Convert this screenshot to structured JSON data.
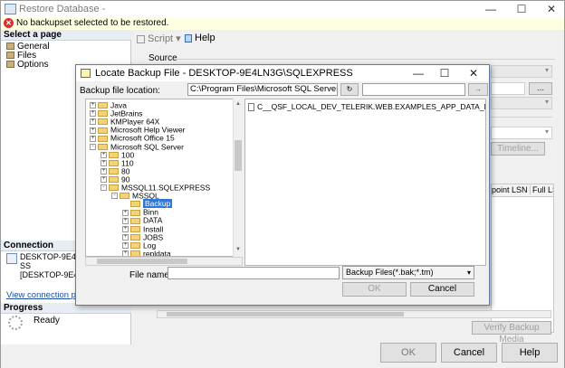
{
  "window": {
    "title": "Restore Database -",
    "warning": "No backupset selected to be restored."
  },
  "left": {
    "select_page_header": "Select a page",
    "pages": [
      {
        "label": "General"
      },
      {
        "label": "Files"
      },
      {
        "label": "Options"
      }
    ],
    "connection_header": "Connection",
    "connection_line1": "DESKTOP-9E4LN",
    "connection_line2": "SS",
    "connection_line3": "[DESKTOP-9E4LN",
    "view_connection_link": "View connection pro",
    "progress_header": "Progress",
    "progress_status": "Ready"
  },
  "toolbar": {
    "script_label": "Script",
    "help_label": "Help"
  },
  "main": {
    "source_label": "Source",
    "browse_button": "...",
    "timeline_button": "Timeline...",
    "col_headers": [
      "point LSN",
      "Full LS"
    ],
    "verify_button": "Verify Backup Media"
  },
  "bottom": {
    "ok": "OK",
    "cancel": "Cancel",
    "help": "Help"
  },
  "dialog": {
    "title": "Locate Backup File - DESKTOP-9E4LN3G\\SQLEXPRESS",
    "location_label": "Backup file location:",
    "location_value": "C:\\Program Files\\Microsoft SQL Server\\MSSQ",
    "tree": [
      {
        "label": "Java",
        "depth": 1,
        "exp": "+"
      },
      {
        "label": "JetBrains",
        "depth": 1,
        "exp": "+"
      },
      {
        "label": "KMPlayer 64X",
        "depth": 1,
        "exp": "+"
      },
      {
        "label": "Microsoft Help Viewer",
        "depth": 1,
        "exp": "+"
      },
      {
        "label": "Microsoft Office 15",
        "depth": 1,
        "exp": "+"
      },
      {
        "label": "Microsoft SQL Server",
        "depth": 1,
        "exp": "-"
      },
      {
        "label": "100",
        "depth": 2,
        "exp": "+"
      },
      {
        "label": "110",
        "depth": 2,
        "exp": "+"
      },
      {
        "label": "80",
        "depth": 2,
        "exp": "+"
      },
      {
        "label": "90",
        "depth": 2,
        "exp": "+"
      },
      {
        "label": "MSSQL11.SQLEXPRESS",
        "depth": 2,
        "exp": "-"
      },
      {
        "label": "MSSQL",
        "depth": 3,
        "exp": "-"
      },
      {
        "label": "Backup",
        "depth": 4,
        "exp": "",
        "selected": true
      },
      {
        "label": "Binn",
        "depth": 4,
        "exp": "+"
      },
      {
        "label": "DATA",
        "depth": 4,
        "exp": "+"
      },
      {
        "label": "Install",
        "depth": 4,
        "exp": "+"
      },
      {
        "label": "JOBS",
        "depth": 4,
        "exp": "+"
      },
      {
        "label": "Log",
        "depth": 4,
        "exp": "+"
      },
      {
        "label": "repldata",
        "depth": 4,
        "exp": "+"
      }
    ],
    "files": [
      "C__QSF_LOCAL_DEV_TELERIK.WEB.EXAMPLES_APP_DATA_NORTH"
    ],
    "file_name_label": "File name:",
    "file_name_value": "",
    "file_type": "Backup Files(*.bak;*.tm)",
    "ok": "OK",
    "cancel": "Cancel"
  }
}
